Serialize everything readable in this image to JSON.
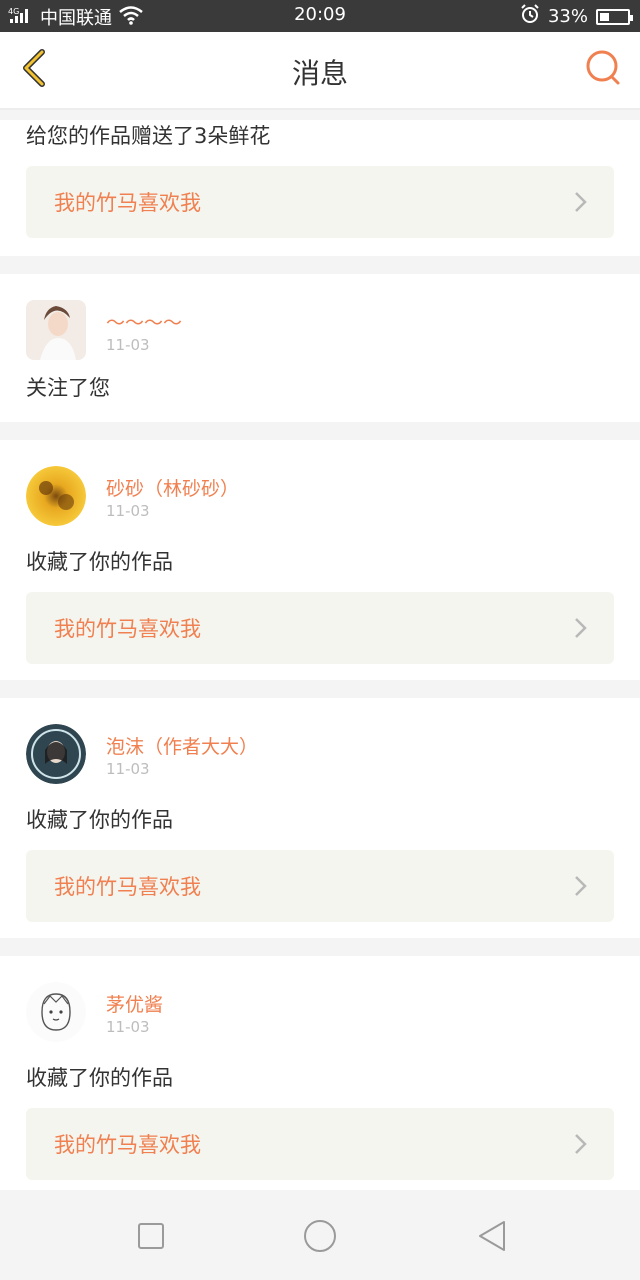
{
  "status_bar": {
    "carrier": "中国联通",
    "time": "20:09",
    "battery": "33%",
    "battery_level": 0.33
  },
  "header": {
    "title": "消息"
  },
  "notifications": [
    {
      "message": "给您的作品赠送了3朵鲜花",
      "work_title": "我的竹马喜欢我"
    },
    {
      "user": "～～～～",
      "date": "11-03",
      "message": "关注了您",
      "avatar": "portrait-girl-white"
    },
    {
      "user": "砂砂（林砂砂）",
      "date": "11-03",
      "message": "收藏了你的作品",
      "work_title": "我的竹马喜欢我",
      "avatar": "sunflower"
    },
    {
      "user": "泡沫（作者大大）",
      "date": "11-03",
      "message": "收藏了你的作品",
      "work_title": "我的竹马喜欢我",
      "avatar": "dark-portrait"
    },
    {
      "user": "茅优酱",
      "date": "11-03",
      "message": "收藏了你的作品",
      "work_title": "我的竹马喜欢我",
      "avatar": "sketch-character"
    }
  ],
  "colors": {
    "accent": "#f08050",
    "back_arrow": "#f2c230"
  },
  "icons": {
    "back": "chevron-left-icon",
    "search": "search-icon",
    "wifi": "wifi-icon",
    "alarm": "alarm-icon"
  }
}
